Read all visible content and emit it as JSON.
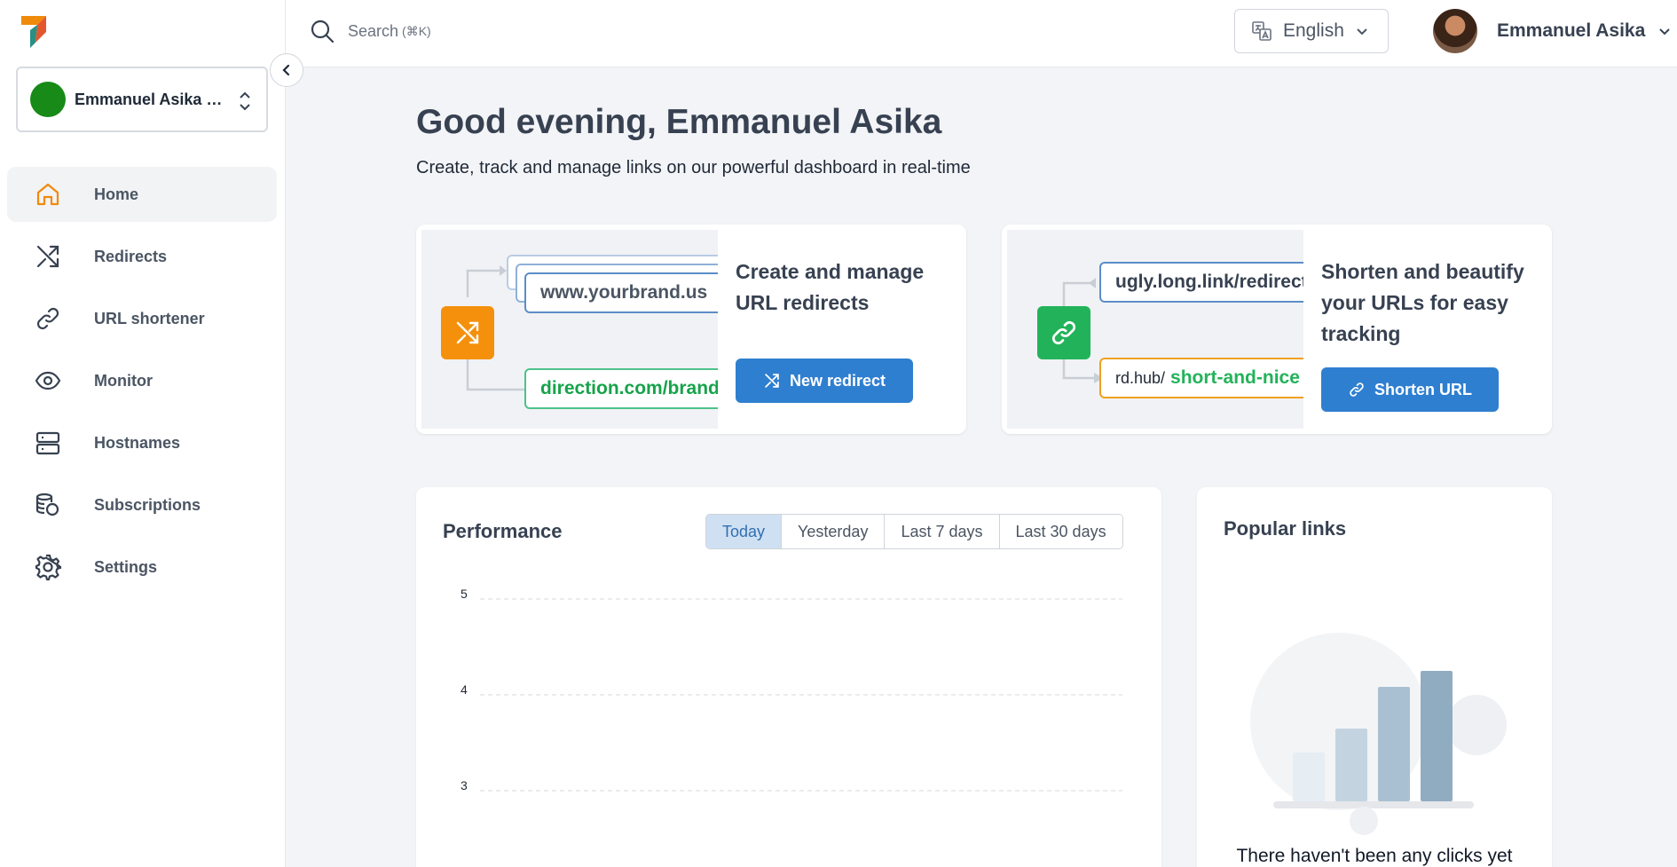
{
  "workspace": {
    "name": "Emmanuel Asika W..."
  },
  "sidebar": {
    "items": [
      {
        "label": "Home",
        "icon": "home-icon"
      },
      {
        "label": "Redirects",
        "icon": "shuffle-icon"
      },
      {
        "label": "URL shortener",
        "icon": "link-icon"
      },
      {
        "label": "Monitor",
        "icon": "eye-icon"
      },
      {
        "label": "Hostnames",
        "icon": "server-icon"
      },
      {
        "label": "Subscriptions",
        "icon": "coins-icon"
      },
      {
        "label": "Settings",
        "icon": "gear-icon"
      }
    ]
  },
  "topbar": {
    "search_label": "Search",
    "search_shortcut": "(⌘K)",
    "language": "English",
    "user_name": "Emmanuel Asika"
  },
  "main": {
    "greeting": "Good evening, Emmanuel Asika",
    "subtitle": "Create, track and manage links on our powerful dashboard in real-time"
  },
  "cards": {
    "redirect": {
      "title": "Create and manage URL redirects",
      "button": "New redirect",
      "source_url": "www.yourbrand.us",
      "target_url": "direction.com/brand"
    },
    "shortener": {
      "title": "Shorten and beautify your URLs for easy tracking",
      "button": "Shorten URL",
      "long_url": "ugly.long.link/redirect",
      "short_prefix": "rd.hub/",
      "short_slug": "short-and-nice"
    }
  },
  "performance": {
    "title": "Performance",
    "ranges": [
      "Today",
      "Yesterday",
      "Last 7 days",
      "Last 30 days"
    ],
    "active_range": "Today",
    "chart_data": {
      "type": "line",
      "title": "",
      "xlabel": "",
      "ylabel": "",
      "y_ticks": [
        5,
        4,
        3
      ],
      "ylim": [
        3,
        5
      ],
      "grid": true,
      "series": []
    }
  },
  "popular": {
    "title": "Popular links",
    "empty_text": "There haven't been any clicks yet"
  },
  "colors": {
    "accent": "#2f7fd0",
    "orange": "#f08a0a",
    "green": "#16a34a",
    "workspace_dot": "#178a17"
  }
}
